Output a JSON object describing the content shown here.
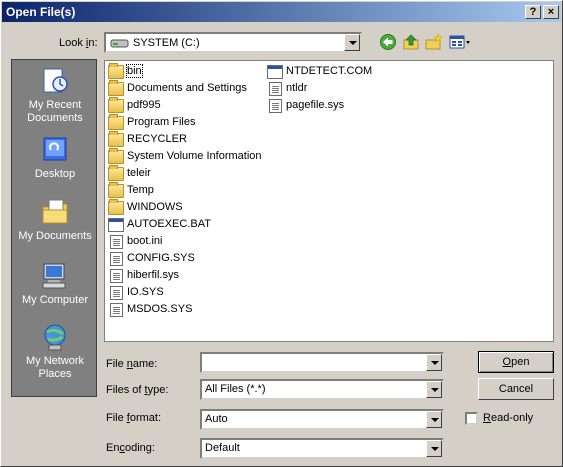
{
  "window": {
    "title": "Open File(s)",
    "help_label": "?",
    "close_label": "×"
  },
  "lookin": {
    "label_pre": "Look ",
    "label_key": "i",
    "label_post": "n:",
    "value": "SYSTEM (C:)"
  },
  "toolbar": {
    "icons": [
      "back-icon",
      "up-folder-icon",
      "new-folder-icon",
      "views-menu-icon"
    ]
  },
  "places": [
    {
      "name": "recent",
      "line1": "My Recent",
      "line2": "Documents",
      "icon": "recent-documents-icon"
    },
    {
      "name": "desktop",
      "line1": "Desktop",
      "line2": "",
      "icon": "desktop-icon"
    },
    {
      "name": "documents",
      "line1": "My Documents",
      "line2": "",
      "icon": "my-documents-icon"
    },
    {
      "name": "computer",
      "line1": "My Computer",
      "line2": "",
      "icon": "my-computer-icon"
    },
    {
      "name": "network",
      "line1": "My Network",
      "line2": "Places",
      "icon": "network-places-icon"
    }
  ],
  "files_col1": [
    {
      "name": "bin",
      "type": "folder"
    },
    {
      "name": "Documents and Settings",
      "type": "folder"
    },
    {
      "name": "pdf995",
      "type": "folder"
    },
    {
      "name": "Program Files",
      "type": "folder"
    },
    {
      "name": "RECYCLER",
      "type": "folder"
    },
    {
      "name": "System Volume Information",
      "type": "folder"
    },
    {
      "name": "teleir",
      "type": "folder"
    },
    {
      "name": "Temp",
      "type": "folder"
    },
    {
      "name": "WINDOWS",
      "type": "folder"
    },
    {
      "name": "AUTOEXEC.BAT",
      "type": "bat"
    },
    {
      "name": "boot.ini",
      "type": "ini"
    },
    {
      "name": "CONFIG.SYS",
      "type": "sys"
    },
    {
      "name": "hiberfil.sys",
      "type": "sys"
    },
    {
      "name": "IO.SYS",
      "type": "sys"
    },
    {
      "name": "MSDOS.SYS",
      "type": "sys"
    }
  ],
  "files_col2": [
    {
      "name": "NTDETECT.COM",
      "type": "com"
    },
    {
      "name": "ntldr",
      "type": "sys"
    },
    {
      "name": "pagefile.sys",
      "type": "sys"
    }
  ],
  "fields": {
    "filename": {
      "label_pre": "File ",
      "label_key": "n",
      "label_post": "ame:",
      "value": ""
    },
    "filetype": {
      "label_pre": "Files of ",
      "label_key": "t",
      "label_post": "ype:",
      "value": "All Files (*.*)"
    },
    "format": {
      "label_pre": "File ",
      "label_key": "f",
      "label_post": "ormat:",
      "value": "Auto"
    },
    "encoding": {
      "label_pre": "En",
      "label_key": "c",
      "label_post": "oding:",
      "value": "Default"
    }
  },
  "buttons": {
    "open": {
      "label_key": "O",
      "label_post": "pen"
    },
    "cancel": {
      "label": "Cancel"
    }
  },
  "readonly": {
    "label_key": "R",
    "label_post": "ead-only",
    "checked": false
  }
}
